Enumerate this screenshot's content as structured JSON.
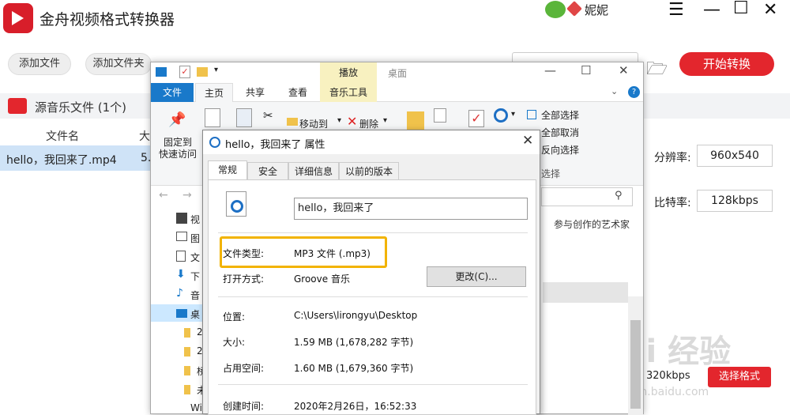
{
  "app": {
    "title": "金舟视频格式转换器",
    "user_name": "妮妮",
    "add_file": "添加文件",
    "add_folder": "添加文件夹",
    "start_convert": "开始转换",
    "section_title": "源音乐文件 (1个)",
    "col_filename": "文件名",
    "col_extra": "大",
    "file_name": "hello，我回来了.mp4",
    "file_extra": "5.",
    "resolution_label": "分辨率:",
    "resolution_value": "960x540",
    "bitrate_label": "比特率:",
    "bitrate_value": "128kbps",
    "bottom_bitrate": "320kbps",
    "choose_format": "选择格式",
    "accent": "#e3262d"
  },
  "explorer": {
    "play_tab": "播放",
    "title": "桌面",
    "tabs": [
      "文件",
      "主页",
      "共享",
      "查看",
      "音乐工具"
    ],
    "ribbon": {
      "pin": "固定到\n快速访问",
      "move_to": "移动到",
      "delete": "删除",
      "select_all": "全部选择",
      "select_none": "全部取消",
      "invert": "反向选择",
      "select_group": "选择"
    },
    "detail_text": "参与创作的艺术家",
    "nav": [
      "视",
      "图",
      "文",
      "下",
      "音",
      "桌",
      "2",
      "2",
      "桥",
      "未",
      "Wi"
    ]
  },
  "props": {
    "title": "hello，我回来了 属性",
    "tabs": [
      "常规",
      "安全",
      "详细信息",
      "以前的版本"
    ],
    "name": "hello，我回来了",
    "type_label": "文件类型:",
    "type_value": "MP3 文件 (.mp3)",
    "open_label": "打开方式:",
    "open_value": "Groove 音乐",
    "change_btn": "更改(C)...",
    "location_label": "位置:",
    "location_value": "C:\\Users\\lirongyu\\Desktop",
    "size_label": "大小:",
    "size_value": "1.59 MB (1,678,282 字节)",
    "disk_label": "占用空间:",
    "disk_value": "1.60 MB (1,679,360 字节)",
    "created_label": "创建时间:",
    "created_value": "2020年2月26日，16:52:33"
  },
  "watermark": {
    "main": "Bai 经验",
    "sub": "jingyan.baidu.com"
  }
}
